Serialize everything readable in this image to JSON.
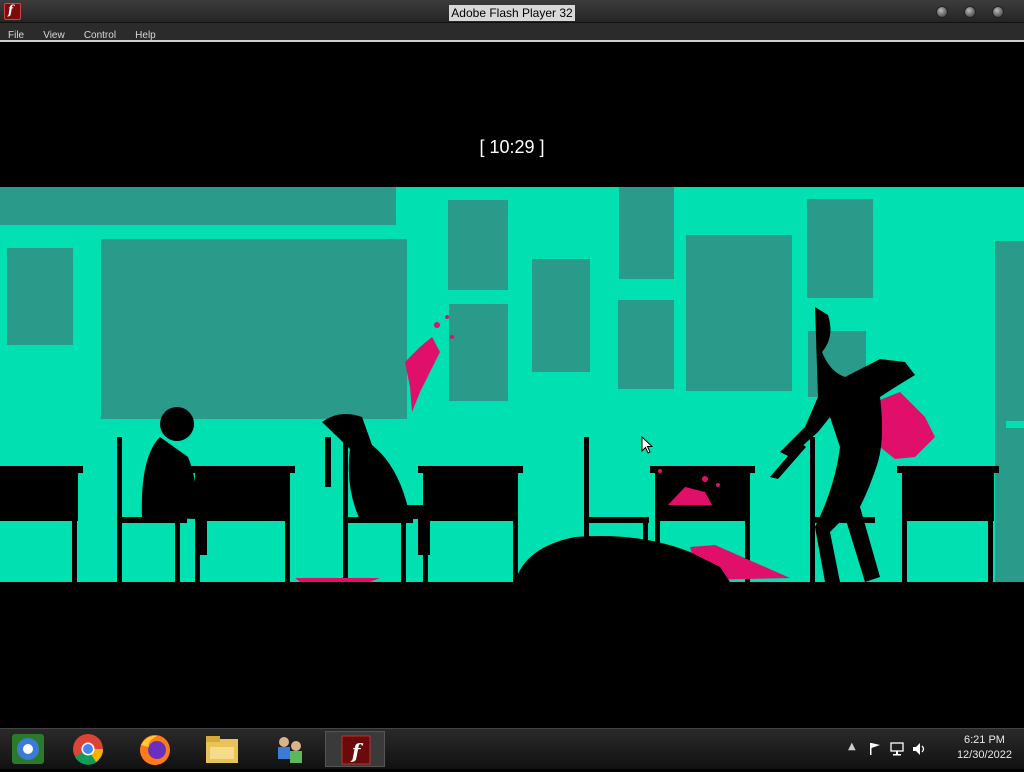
{
  "window": {
    "title": "Adobe Flash Player 32",
    "icon": "flash-f-icon"
  },
  "menu": [
    "File",
    "View",
    "Control",
    "Help"
  ],
  "game": {
    "timer": "[ 10:29 ]",
    "colors": {
      "background": "#00e0b0",
      "panels": "#2a9a8a",
      "silhouette": "#000000",
      "blood": "#e0106a"
    }
  },
  "taskbar": {
    "apps": [
      {
        "name": "chromium-icon"
      },
      {
        "name": "chrome-icon"
      },
      {
        "name": "firefox-icon"
      },
      {
        "name": "file-explorer-icon"
      },
      {
        "name": "network-people-icon"
      },
      {
        "name": "flash-player-icon",
        "active": true
      }
    ],
    "tray_icons": [
      "show-hidden-icons-caret",
      "action-center-flag-icon",
      "network-icon",
      "volume-icon"
    ],
    "clock_time": "6:21 PM",
    "clock_date": "12/30/2022"
  }
}
